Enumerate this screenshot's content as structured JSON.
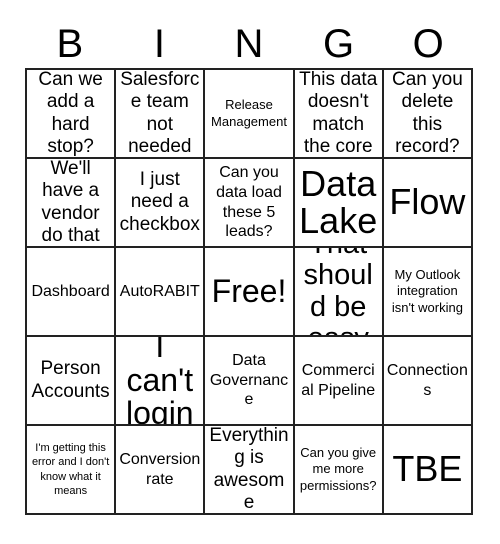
{
  "card": {
    "title": "BINGO",
    "header_letters": [
      "B",
      "I",
      "N",
      "G",
      "O"
    ],
    "colors": {
      "background": "#ffffff",
      "text": "#000000",
      "grid_line": "#222222"
    },
    "grid": {
      "columns": 5,
      "rows": 5,
      "cells": [
        [
          {
            "text": "Can we add a hard stop?",
            "size": "md"
          },
          {
            "text": "Salesforce team not needed",
            "size": "md"
          },
          {
            "text": "Release Management",
            "size": "xs"
          },
          {
            "text": "This data doesn't match the core",
            "size": "md"
          },
          {
            "text": "Can you delete this record?",
            "size": "md"
          }
        ],
        [
          {
            "text": "We'll have a vendor do that",
            "size": "md"
          },
          {
            "text": "I just need a checkbox",
            "size": "md"
          },
          {
            "text": "Can you data load these 5 leads?",
            "size": "sm"
          },
          {
            "text": "Data Lake",
            "size": "xxl"
          },
          {
            "text": "Flow",
            "size": "xxl"
          }
        ],
        [
          {
            "text": "Dashboard",
            "size": "sm"
          },
          {
            "text": "AutoRABIT",
            "size": "sm"
          },
          {
            "text": "Free!",
            "size": "xl"
          },
          {
            "text": "That should be easy",
            "size": "lg"
          },
          {
            "text": "My Outlook integration isn't working",
            "size": "xs"
          }
        ],
        [
          {
            "text": "Person Accounts",
            "size": "md"
          },
          {
            "text": "I can't login",
            "size": "xl"
          },
          {
            "text": "Data Governance",
            "size": "sm"
          },
          {
            "text": "Commercial Pipeline",
            "size": "sm"
          },
          {
            "text": "Connections",
            "size": "sm"
          }
        ],
        [
          {
            "text": "I'm getting this error and I don't know what it means",
            "size": "xxs"
          },
          {
            "text": "Conversion rate",
            "size": "sm"
          },
          {
            "text": "Everything is awesome",
            "size": "md"
          },
          {
            "text": "Can you give me more permissions?",
            "size": "xs"
          },
          {
            "text": "TBE",
            "size": "xxl"
          }
        ]
      ]
    }
  }
}
